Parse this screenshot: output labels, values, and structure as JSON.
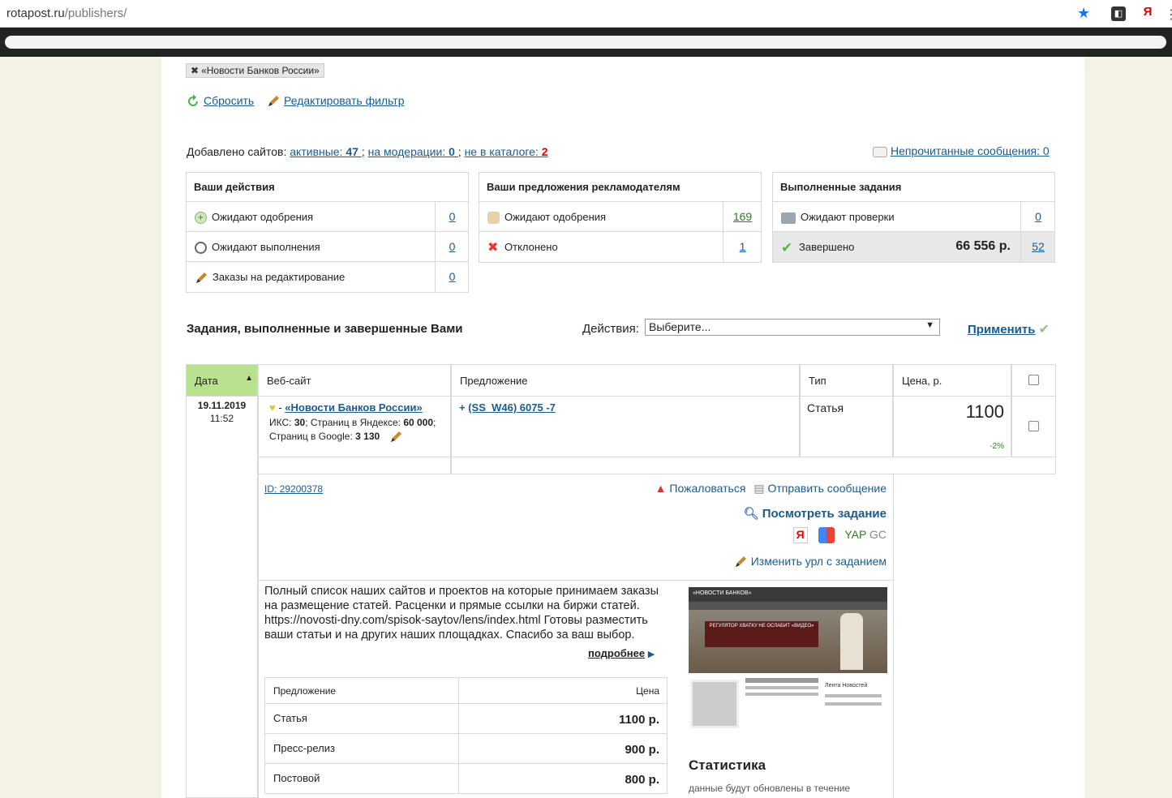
{
  "browser": {
    "url_host": "rotapost.ru",
    "url_path": "/publishers/"
  },
  "filter": {
    "tag": "«Новости Банков России»",
    "reset": "Сбросить",
    "edit": "Редактировать фильтр"
  },
  "sites": {
    "prefix": "Добавлено сайтов:",
    "active_label": "активные:",
    "active_count": "47",
    "moderation_label": "на модерации:",
    "moderation_count": "0",
    "not_catalog_label": "не в каталоге:",
    "not_catalog_count": "2",
    "unread": "Непрочитанные сообщения: 0"
  },
  "actions_box": {
    "title": "Ваши действия",
    "rows": [
      {
        "label": "Ожидают одобрения",
        "count": "0"
      },
      {
        "label": "Ожидают выполнения",
        "count": "0"
      },
      {
        "label": "Заказы на редактирование",
        "count": "0"
      }
    ]
  },
  "offers_box": {
    "title": "Ваши предложения рекламодателям",
    "rows": [
      {
        "label": "Ожидают одобрения",
        "count": "169"
      },
      {
        "label": "Отклонено",
        "count": "1"
      }
    ]
  },
  "done_box": {
    "title": "Выполненные задания",
    "rows": [
      {
        "label": "Ожидают проверки",
        "count": "0"
      },
      {
        "label": "Завершено",
        "amount": "66 556 р.",
        "count": "52"
      }
    ]
  },
  "tasks": {
    "title": "Задания, выполненные и завершенные Вами",
    "actions_label": "Действия:",
    "select_value": "Выберите...",
    "apply": "Применить",
    "columns": [
      "Дата",
      "Веб-сайт",
      "Предложение",
      "Тип",
      "Цена, р."
    ],
    "row": {
      "date": "19.11.2019",
      "time": "11:52",
      "site_name": "«Новости Банков России»",
      "iks_label": "ИКС:",
      "iks": "30",
      "yandex_label": "Страниц в Яндексе:",
      "yandex": "60 000",
      "google_label": "Страниц в Google:",
      "google": "3 130",
      "offer": "(SS_W46) 6075 -7",
      "type": "Статья",
      "price": "1100",
      "discount": "-2%",
      "id": "ID: 29200378",
      "complain": "Пожаловаться",
      "send_message": "Отправить сообщение",
      "view_task": "Посмотреть задание",
      "yap": "YAP",
      "gc": "GC",
      "change_url": "Изменить урл с заданием"
    }
  },
  "description": {
    "text": "Полный список наших сайтов и проектов на которые принимаем заказы на размещение статей. Расценки и прямые ссылки на биржи статей. https://novosti-dny.com/spisok-saytov/lens/index.html Готовы разместить ваши статьи и на других наших площадках. Спасибо за ваш выбор.",
    "more": "подробнее"
  },
  "offers_table": {
    "header": [
      "Предложение",
      "Цена"
    ],
    "rows": [
      {
        "name": "Статья",
        "price": "1100 р."
      },
      {
        "name": "Пресс-релиз",
        "price": "900 р."
      },
      {
        "name": "Постовой",
        "price": "800 р."
      }
    ]
  },
  "thumb": {
    "site_title": "«НОВОСТИ БАНКОВ»",
    "banner": "РЕГУЛЯТОР ХВАТКУ НЕ ОСЛАБИТ «ВИДЕО»",
    "news": "Лента Новостей"
  },
  "stats": {
    "title": "Статистика",
    "note": "данные будут обновлены в течение"
  }
}
